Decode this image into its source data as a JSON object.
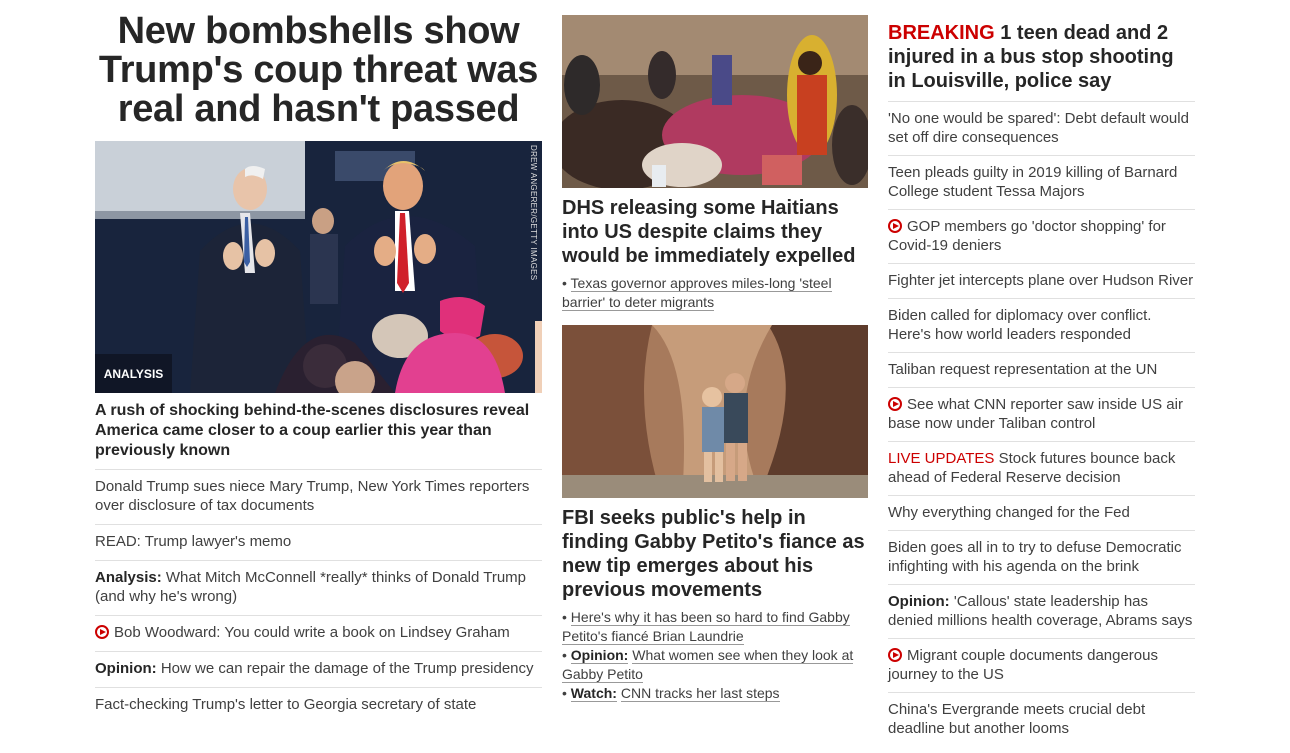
{
  "main": {
    "headline": "New bombshells show Trump's coup threat was real and hasn't passed",
    "badge": "ANALYSIS",
    "photo_credit": "DREW ANGERER/GETTY IMAGES",
    "subheadline": "A rush of shocking behind-the-scenes disclosures reveal America came closer to a coup earlier this year than previously known",
    "related": [
      {
        "prefix": "",
        "text": "Donald Trump sues niece Mary Trump, New York Times reporters over disclosure of tax documents",
        "video": false
      },
      {
        "prefix": "",
        "text": "READ: Trump lawyer's memo",
        "video": false
      },
      {
        "prefix": "Analysis:",
        "text": "What Mitch McConnell *really* thinks of Donald Trump (and why he's wrong)",
        "video": false
      },
      {
        "prefix": "",
        "text": "Bob Woodward: You could write a book on Lindsey Graham",
        "video": true
      },
      {
        "prefix": "Opinion:",
        "text": "How we can repair the damage of the Trump presidency",
        "video": false
      },
      {
        "prefix": "",
        "text": "Fact-checking Trump's letter to Georgia secretary of state",
        "video": false
      }
    ]
  },
  "middle": {
    "story1": {
      "headline": "DHS releasing some Haitians into US despite claims they would be immediately expelled",
      "bullets": [
        {
          "prefix": "",
          "text": "Texas governor approves miles-long 'steel barrier' to deter migrants"
        }
      ]
    },
    "story2": {
      "headline": "FBI seeks public's help in finding Gabby Petito's fiance as new tip emerges about his previous movements",
      "bullets": [
        {
          "prefix": "",
          "text": "Here's why it has been so hard to find Gabby Petito's fiancé Brian Laundrie"
        },
        {
          "prefix": "Opinion:",
          "text": "What women see when they look at Gabby Petito"
        },
        {
          "prefix": "Watch:",
          "text": "CNN tracks her last steps"
        }
      ]
    }
  },
  "right": {
    "breaking_label": "BREAKING",
    "breaking_text": "1 teen dead and 2 injured in a bus stop shooting in Louisville, police say",
    "items": [
      {
        "prefix": "",
        "live": "",
        "text": "'No one would be spared': Debt default would set off dire consequences",
        "video": false
      },
      {
        "prefix": "",
        "live": "",
        "text": "Teen pleads guilty in 2019 killing of Barnard College student Tessa Majors",
        "video": false
      },
      {
        "prefix": "",
        "live": "",
        "text": "GOP members go 'doctor shopping' for Covid-19 deniers",
        "video": true
      },
      {
        "prefix": "",
        "live": "",
        "text": "Fighter jet intercepts plane over Hudson River",
        "video": false
      },
      {
        "prefix": "",
        "live": "",
        "text": "Biden called for diplomacy over conflict. Here's how world leaders responded",
        "video": false
      },
      {
        "prefix": "",
        "live": "",
        "text": "Taliban request representation at the UN",
        "video": false
      },
      {
        "prefix": "",
        "live": "",
        "text": "See what CNN reporter saw inside US air base now under Taliban control",
        "video": true
      },
      {
        "prefix": "",
        "live": "LIVE UPDATES",
        "text": "Stock futures bounce back ahead of Federal Reserve decision",
        "video": false
      },
      {
        "prefix": "",
        "live": "",
        "text": "Why everything changed for the Fed",
        "video": false
      },
      {
        "prefix": "",
        "live": "",
        "text": "Biden goes all in to try to defuse Democratic infighting with his agenda on the brink",
        "video": false
      },
      {
        "prefix": "Opinion:",
        "live": "",
        "text": "'Callous' state leadership has denied millions health coverage, Abrams says",
        "video": false
      },
      {
        "prefix": "",
        "live": "",
        "text": "Migrant couple documents dangerous journey to the US",
        "video": true
      },
      {
        "prefix": "",
        "live": "",
        "text": "China's Evergrande meets crucial debt deadline but another looms",
        "video": false
      }
    ]
  },
  "colors": {
    "brand_red": "#cc0000",
    "text": "#262626",
    "divider": "#e0e0e0"
  }
}
